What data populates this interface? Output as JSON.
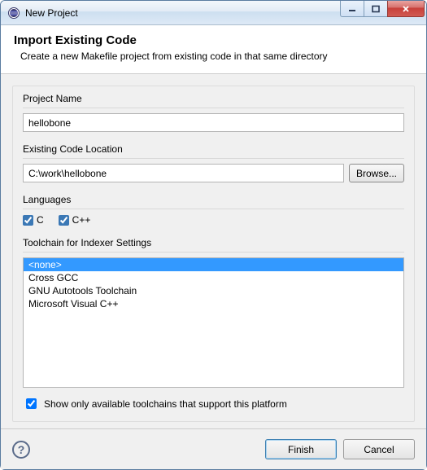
{
  "window": {
    "title": "New Project"
  },
  "header": {
    "title": "Import Existing Code",
    "subtitle": "Create a new Makefile project from existing code in that same directory"
  },
  "form": {
    "projectNameLabel": "Project Name",
    "projectNameValue": "hellobone",
    "codeLocationLabel": "Existing Code Location",
    "codeLocationValue": "C:\\work\\hellobone",
    "browseLabel": "Browse...",
    "languagesLabel": "Languages",
    "langC": "C",
    "langCpp": "C++",
    "langCChecked": true,
    "langCppChecked": true,
    "toolchainLabel": "Toolchain for Indexer Settings",
    "toolchains": [
      {
        "label": "<none>",
        "selected": true
      },
      {
        "label": "Cross GCC",
        "selected": false
      },
      {
        "label": "GNU Autotools Toolchain",
        "selected": false
      },
      {
        "label": "Microsoft Visual C++",
        "selected": false
      }
    ],
    "showOnlyLabel": "Show only available toolchains that support this platform",
    "showOnlyChecked": true
  },
  "footer": {
    "finishLabel": "Finish",
    "cancelLabel": "Cancel"
  }
}
